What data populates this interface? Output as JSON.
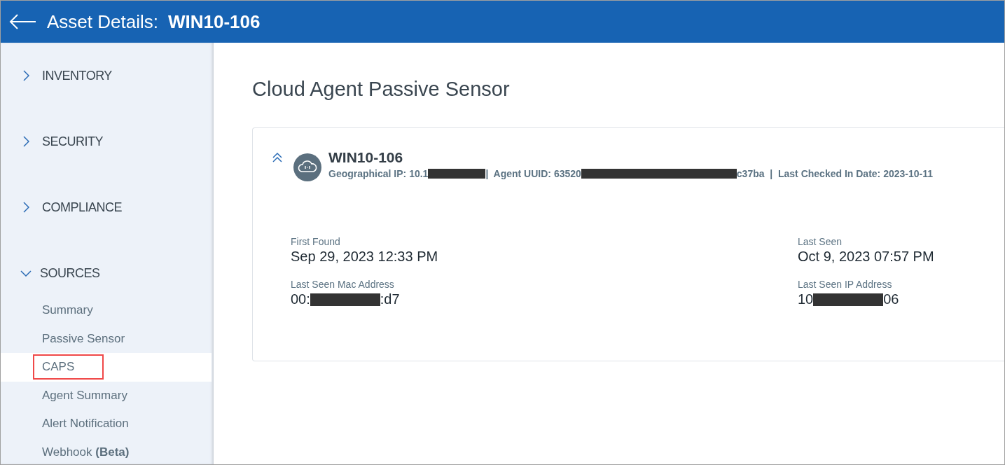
{
  "header": {
    "label": "Asset Details:",
    "asset": "WIN10-106"
  },
  "sidebar": {
    "sections": [
      {
        "label": "INVENTORY",
        "expanded": false
      },
      {
        "label": "SECURITY",
        "expanded": false
      },
      {
        "label": "COMPLIANCE",
        "expanded": false
      },
      {
        "label": "SOURCES",
        "expanded": true,
        "items": [
          {
            "label": "Summary",
            "selected": false,
            "annotated": false
          },
          {
            "label": "Passive Sensor",
            "selected": false,
            "annotated": false
          },
          {
            "label": "CAPS",
            "selected": true,
            "annotated": true
          },
          {
            "label": "Agent Summary",
            "selected": false,
            "annotated": false
          },
          {
            "label": "Alert Notification",
            "selected": false,
            "annotated": false
          },
          {
            "label": "Webhook **(Beta)**",
            "selected": false,
            "annotated": false
          }
        ]
      }
    ]
  },
  "page": {
    "title": "Cloud Agent Passive Sensor",
    "card": {
      "expanded": true,
      "name": "WIN10-106",
      "meta": [
        {
          "kind": "text",
          "text": "Geographical IP: 10.1"
        },
        {
          "kind": "redaction"
        },
        {
          "kind": "text",
          "text": "|  Agent UUID: 63520"
        },
        {
          "kind": "redaction",
          "wide": true
        },
        {
          "kind": "text",
          "text": "c37ba  |  Last Checked In Date: 2023-10-11"
        }
      ],
      "fields": [
        {
          "label": "First Found",
          "value": [
            {
              "kind": "text",
              "text": "Sep 29, 2023 12:33 PM"
            }
          ]
        },
        {
          "label": "Last Seen",
          "value": [
            {
              "kind": "text",
              "text": "Oct 9, 2023 07:57 PM"
            }
          ]
        },
        {
          "label": "Last Seen Mac Address",
          "value": [
            {
              "kind": "text",
              "text": "00:"
            },
            {
              "kind": "redaction"
            },
            {
              "kind": "text",
              "text": ":d7"
            }
          ]
        },
        {
          "label": "Last Seen IP Address",
          "value": [
            {
              "kind": "text",
              "text": "10"
            },
            {
              "kind": "redaction"
            },
            {
              "kind": "text",
              "text": "06"
            }
          ]
        }
      ]
    }
  }
}
